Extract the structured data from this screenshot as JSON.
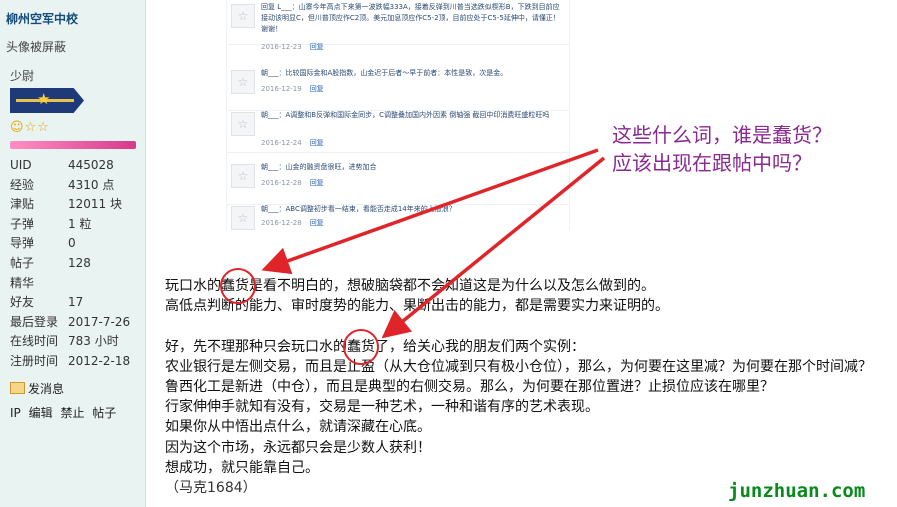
{
  "sidebar": {
    "username": "柳州空军中校",
    "avatar_note": "头像被屏蔽",
    "rank": "少尉",
    "stars": "☺☆☆",
    "exp_progress": 1.0,
    "stats": [
      {
        "label": "UID",
        "value": "445028"
      },
      {
        "label": "经验",
        "value": "4310 点"
      },
      {
        "label": "津贴",
        "value": "12011 块"
      },
      {
        "label": "子弹",
        "value": "1 粒"
      },
      {
        "label": "导弹",
        "value": "0"
      },
      {
        "label": "帖子",
        "value": "128"
      },
      {
        "label": "精华",
        "value": ""
      },
      {
        "label": "好友",
        "value": "17"
      },
      {
        "label": "最后登录",
        "value": "2017-7-26"
      },
      {
        "label": "在线时间",
        "value": "783 小时"
      },
      {
        "label": "注册时间",
        "value": "2012-2-18"
      }
    ],
    "pm_label": "发消息",
    "admin_links": [
      "IP",
      "编辑",
      "禁止",
      "帖子"
    ]
  },
  "screenshot": {
    "replies": [
      {
        "text": "回复 L___：山寨今年高点下来第一波跌幅333A，接着反弹到川普当选跌似楔形B，下跌到目前应接动该明显C，但川普顶应作C2顶。美元加息顶应作C5-2顶，目前应处于C5-5延伸中，请懂正！谢谢！",
        "date": "2016-12-23",
        "reply": "回复"
      },
      {
        "text": "朝___：比较国际金和A股指数，山金迟于后者～早于前者：本性是致，次是金。",
        "date": "2016-12-19",
        "reply": "回复"
      },
      {
        "text": "朝___：A调整和B反弹和国际金同步，C调整叠加国内外因素 倒轴强 截回中印消费旺盛粒旺吗",
        "date": "2016-12-24",
        "reply": "回复"
      },
      {
        "text": "朝___：山金的融资盘很旺，进势加合",
        "date": "2016-12-28",
        "reply": "回复"
      },
      {
        "text": "朝___：ABC调整初步看一结束，看能否走成14年来的上涨浪？",
        "date": "2016-12-28",
        "reply": "回复"
      }
    ]
  },
  "annotation": {
    "line1": "这些什么词，谁是蠢货？",
    "line2": "应该出现在跟帖中吗？"
  },
  "post": {
    "line1": "玩口水的蠢货是看不明白的，想破脑袋都不会知道这是为什么以及怎么做到的。",
    "line2": "高低点判断的能力、审时度势的能力、果断出击的能力，都是需要实力来证明的。",
    "line3": "好，先不理那种只会玩口水的蠢货了，给关心我的朋友们两个实例：",
    "line4": "农业银行是左侧交易，而且是止盈（从大仓位减到只有极小仓位），那么，为何要在这里减？为何要在那个时间减？",
    "line5": "鲁西化工是新进（中仓），而且是典型的右侧交易。那么，为何要在那位置进？止损位应该在哪里？",
    "line6": "行家伸伸手就知有没有，交易是一种艺术，一种和谐有序的艺术表现。",
    "line7": "如果你从中悟出点什么，就请深藏在心底。",
    "line8": "因为这个市场，永远都只会是少数人获利！",
    "line9": "想成功，就只能靠自己。",
    "signature": "（马克1684）"
  },
  "watermark": "junzhuan.com",
  "colors": {
    "sidebar_bg": "#e8f3f2",
    "username": "#154c7a",
    "annotation": "#8a2a91",
    "highlight_circle": "#e0252a",
    "watermark": "#0a8a1c"
  }
}
